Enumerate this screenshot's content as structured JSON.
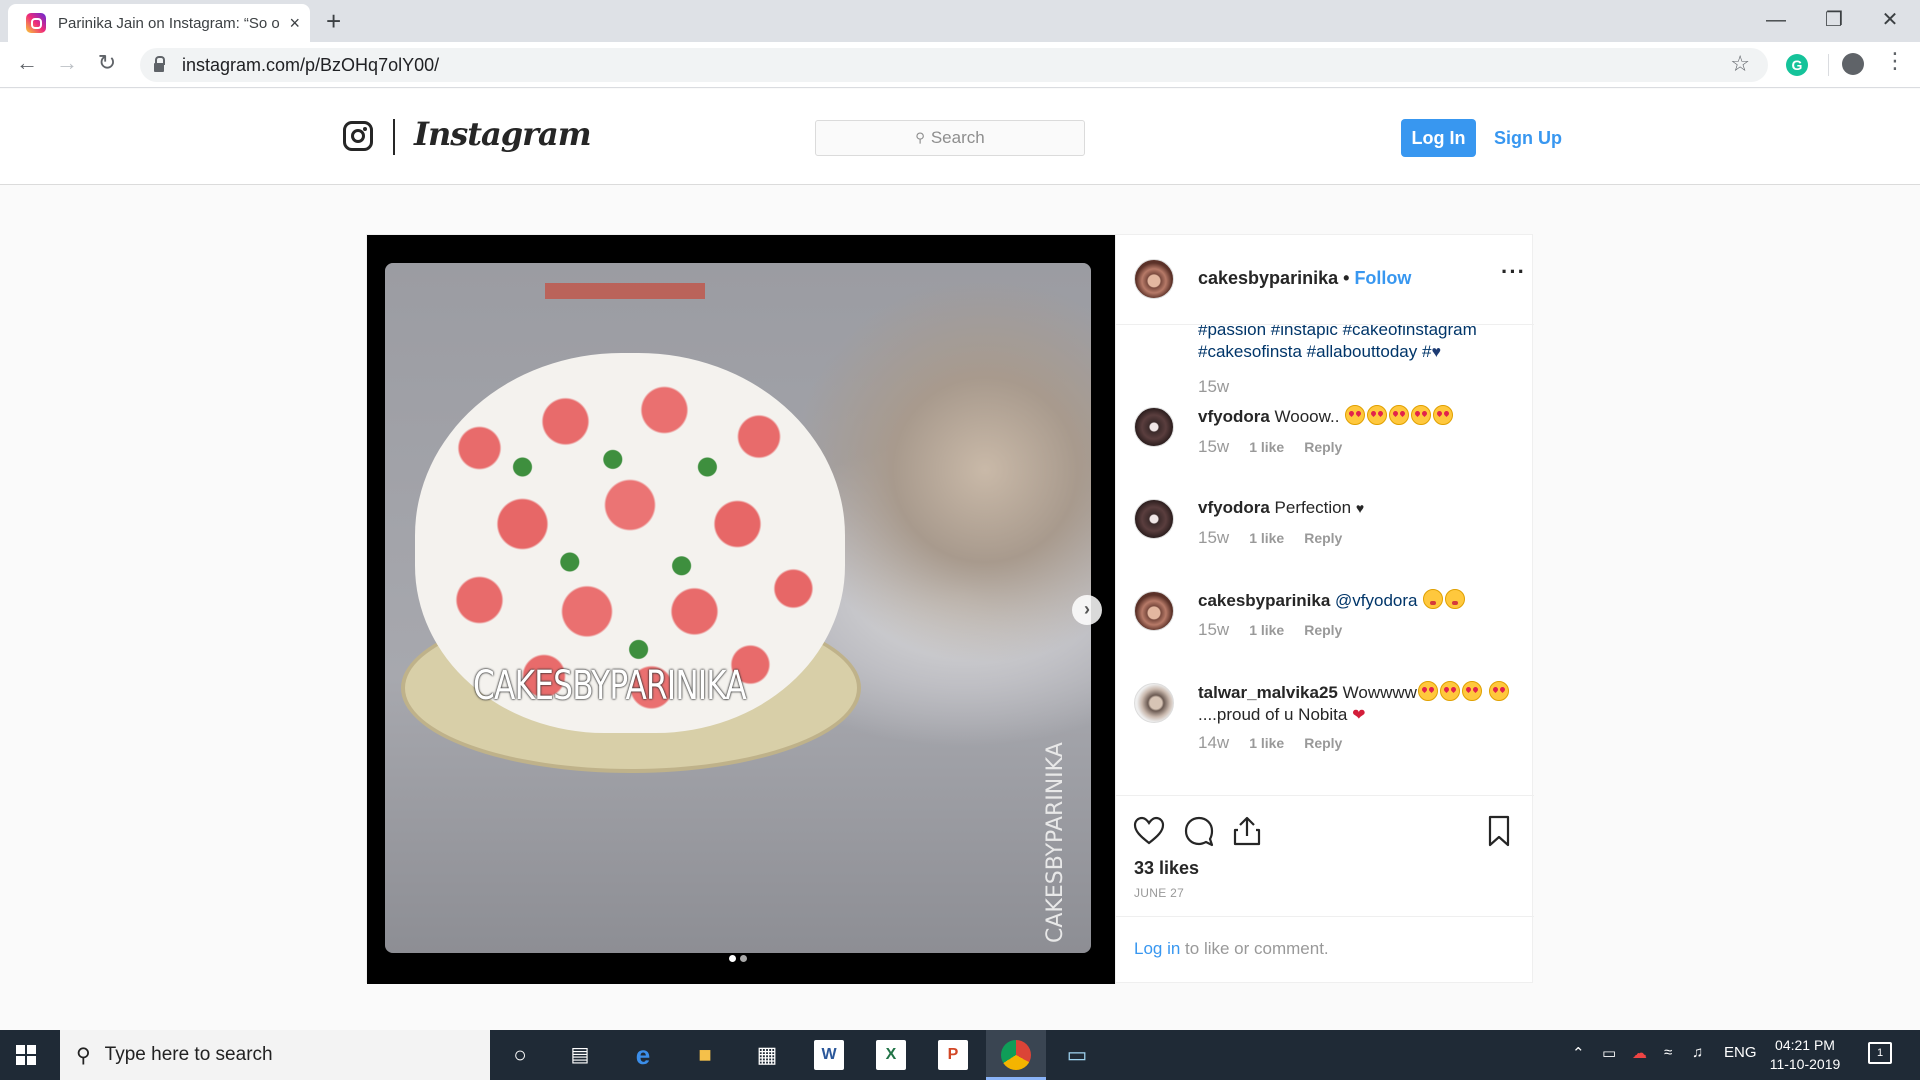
{
  "browser": {
    "tab_title": "Parinika Jain on Instagram: “So o",
    "tab_close": "×",
    "new_tab": "+",
    "url": "instagram.com/p/BzOHq7olY00/",
    "grammarly": "G",
    "window_controls": {
      "minimize": "—",
      "maximize": "❐",
      "close": "✕"
    }
  },
  "header": {
    "wordmark": "Instagram",
    "search_placeholder": "Search",
    "login_label": "Log In",
    "signup_label": "Sign Up",
    "accent_color": "#3897f0"
  },
  "post": {
    "username": "cakesbyparinika",
    "separator": "•",
    "follow_label": "Follow",
    "image_watermark": "CAKESBYPARINIKA",
    "image_watermark_vertical": "CAKESBYPARINIKA",
    "caption_tags": "#passion #instapic #cakeofinstagram #cakesofinsta #allabouttoday #",
    "caption_time": "15w",
    "comments": [
      {
        "user": "vfyodora",
        "text": "Wooow..",
        "time": "15w",
        "likes": "1 like",
        "reply": "Reply"
      },
      {
        "user": "vfyodora",
        "text": "Perfection",
        "time": "15w",
        "likes": "1 like",
        "reply": "Reply"
      },
      {
        "user": "cakesbyparinika",
        "mention": "@vfyodora",
        "time": "15w",
        "likes": "1 like",
        "reply": "Reply"
      },
      {
        "user": "talwar_malvika25",
        "text": "Wowwww",
        "text2": "....proud of u Nobita",
        "time": "14w",
        "likes": "1 like",
        "reply": "Reply"
      }
    ],
    "likes_count": "33 likes",
    "date": "JUNE 27",
    "login_link": "Log in",
    "login_suffix": " to like or comment.",
    "carousel_dots": 2,
    "carousel_active": 0
  },
  "taskbar": {
    "search_placeholder": "Type here to search",
    "language": "ENG",
    "time": "04:21 PM",
    "date": "11-10-2019",
    "notification_count": "1"
  }
}
